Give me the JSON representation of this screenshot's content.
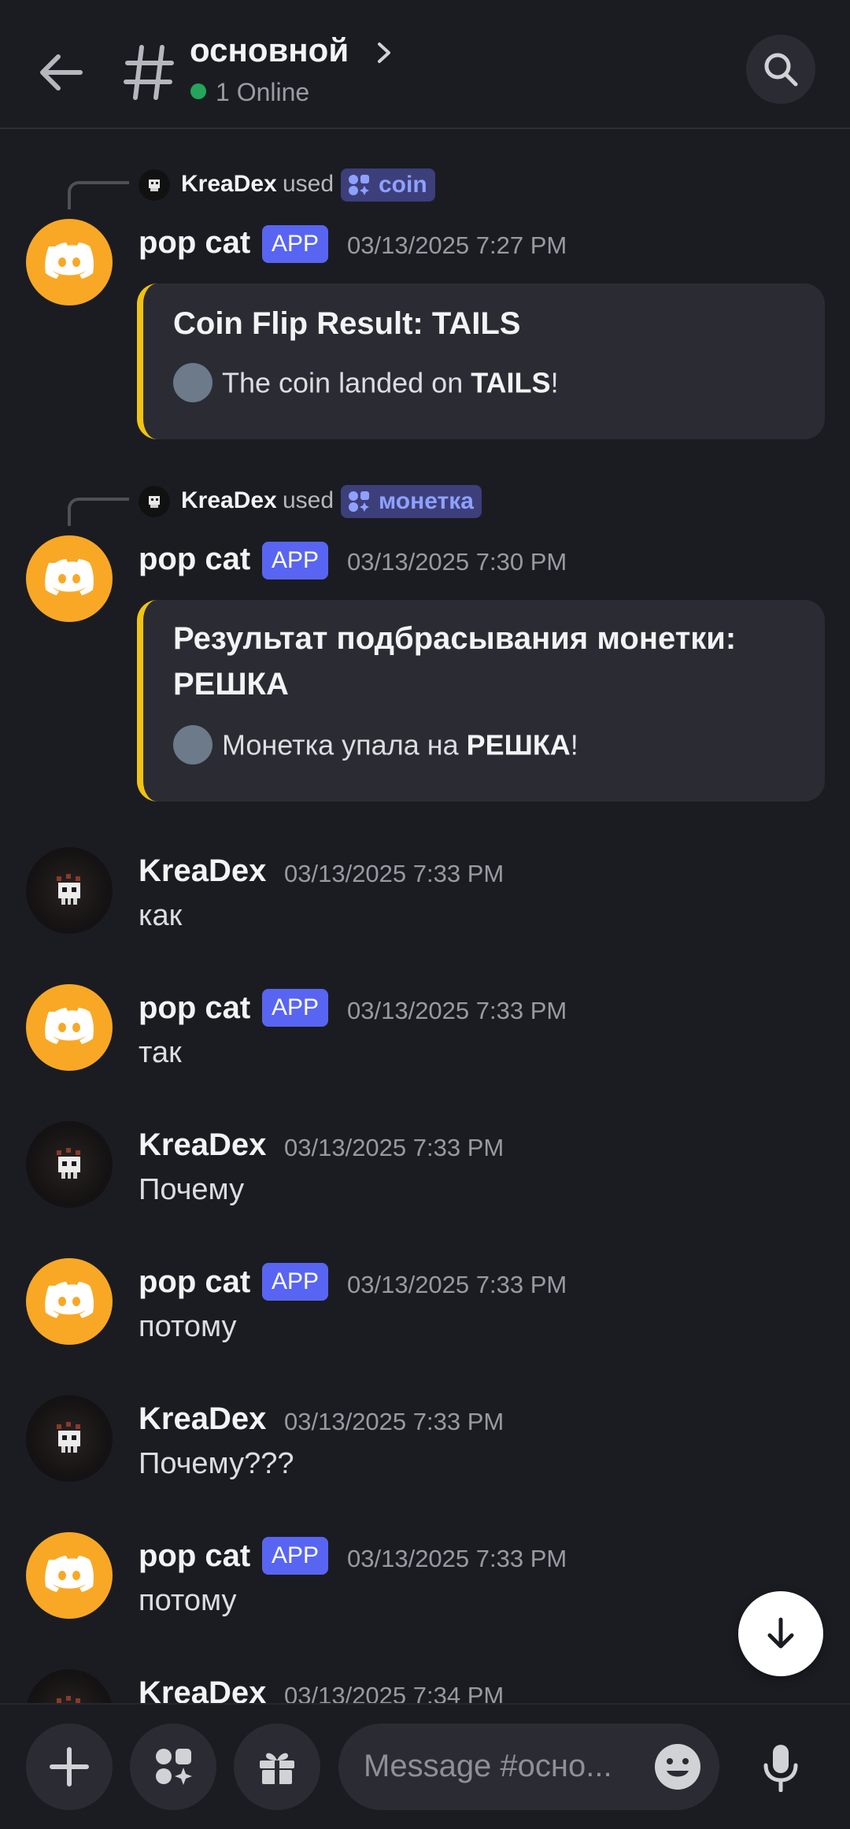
{
  "header": {
    "channel": "основной",
    "online": "1 Online"
  },
  "messages": [
    {
      "used_by": "KreaDex",
      "used_word": "used",
      "command": "coin",
      "author": "pop cat",
      "badge": "APP",
      "timestamp": "03/13/2025 7:27 PM",
      "embed_title": "Coin Flip Result: TAILS",
      "embed_desc_prefix": "The coin landed on ",
      "embed_desc_bold": "TAILS",
      "embed_desc_suffix": "!"
    },
    {
      "used_by": "KreaDex",
      "used_word": "used",
      "command": "монетка",
      "author": "pop cat",
      "badge": "APP",
      "timestamp": "03/13/2025 7:30 PM",
      "embed_title_line1": "Результат подбрасывания монетки:",
      "embed_title_line2": "РЕШКА",
      "embed_desc_prefix": "Монетка упала на ",
      "embed_desc_bold": "РЕШКА",
      "embed_desc_suffix": "!"
    },
    {
      "author": "KreaDex",
      "timestamp": "03/13/2025 7:33 PM",
      "text": "как"
    },
    {
      "author": "pop cat",
      "badge": "APP",
      "timestamp": "03/13/2025 7:33 PM",
      "text": "так"
    },
    {
      "author": "KreaDex",
      "timestamp": "03/13/2025 7:33 PM",
      "text": "Почему"
    },
    {
      "author": "pop cat",
      "badge": "APP",
      "timestamp": "03/13/2025 7:33 PM",
      "text": "потому"
    },
    {
      "author": "KreaDex",
      "timestamp": "03/13/2025 7:33 PM",
      "text": "Почему???"
    },
    {
      "author": "pop cat",
      "badge": "APP",
      "timestamp": "03/13/2025 7:33 PM",
      "text": "потому"
    },
    {
      "author": "KreaDex",
      "timestamp": "03/13/2025 7:34 PM"
    }
  ],
  "composer": {
    "placeholder": "Message #осно..."
  },
  "colors": {
    "background": "#1b1c22",
    "accent_app_badge": "#5865f2",
    "bot_avatar": "#f9a825",
    "embed_border": "#f1c40f",
    "online": "#23a55a"
  },
  "icons": [
    "back-arrow-icon",
    "hash-icon",
    "chevron-right-icon",
    "search-icon",
    "discord-logo-icon",
    "apps-icon",
    "plus-icon",
    "gift-icon",
    "emoji-icon",
    "microphone-icon",
    "arrow-down-icon"
  ]
}
